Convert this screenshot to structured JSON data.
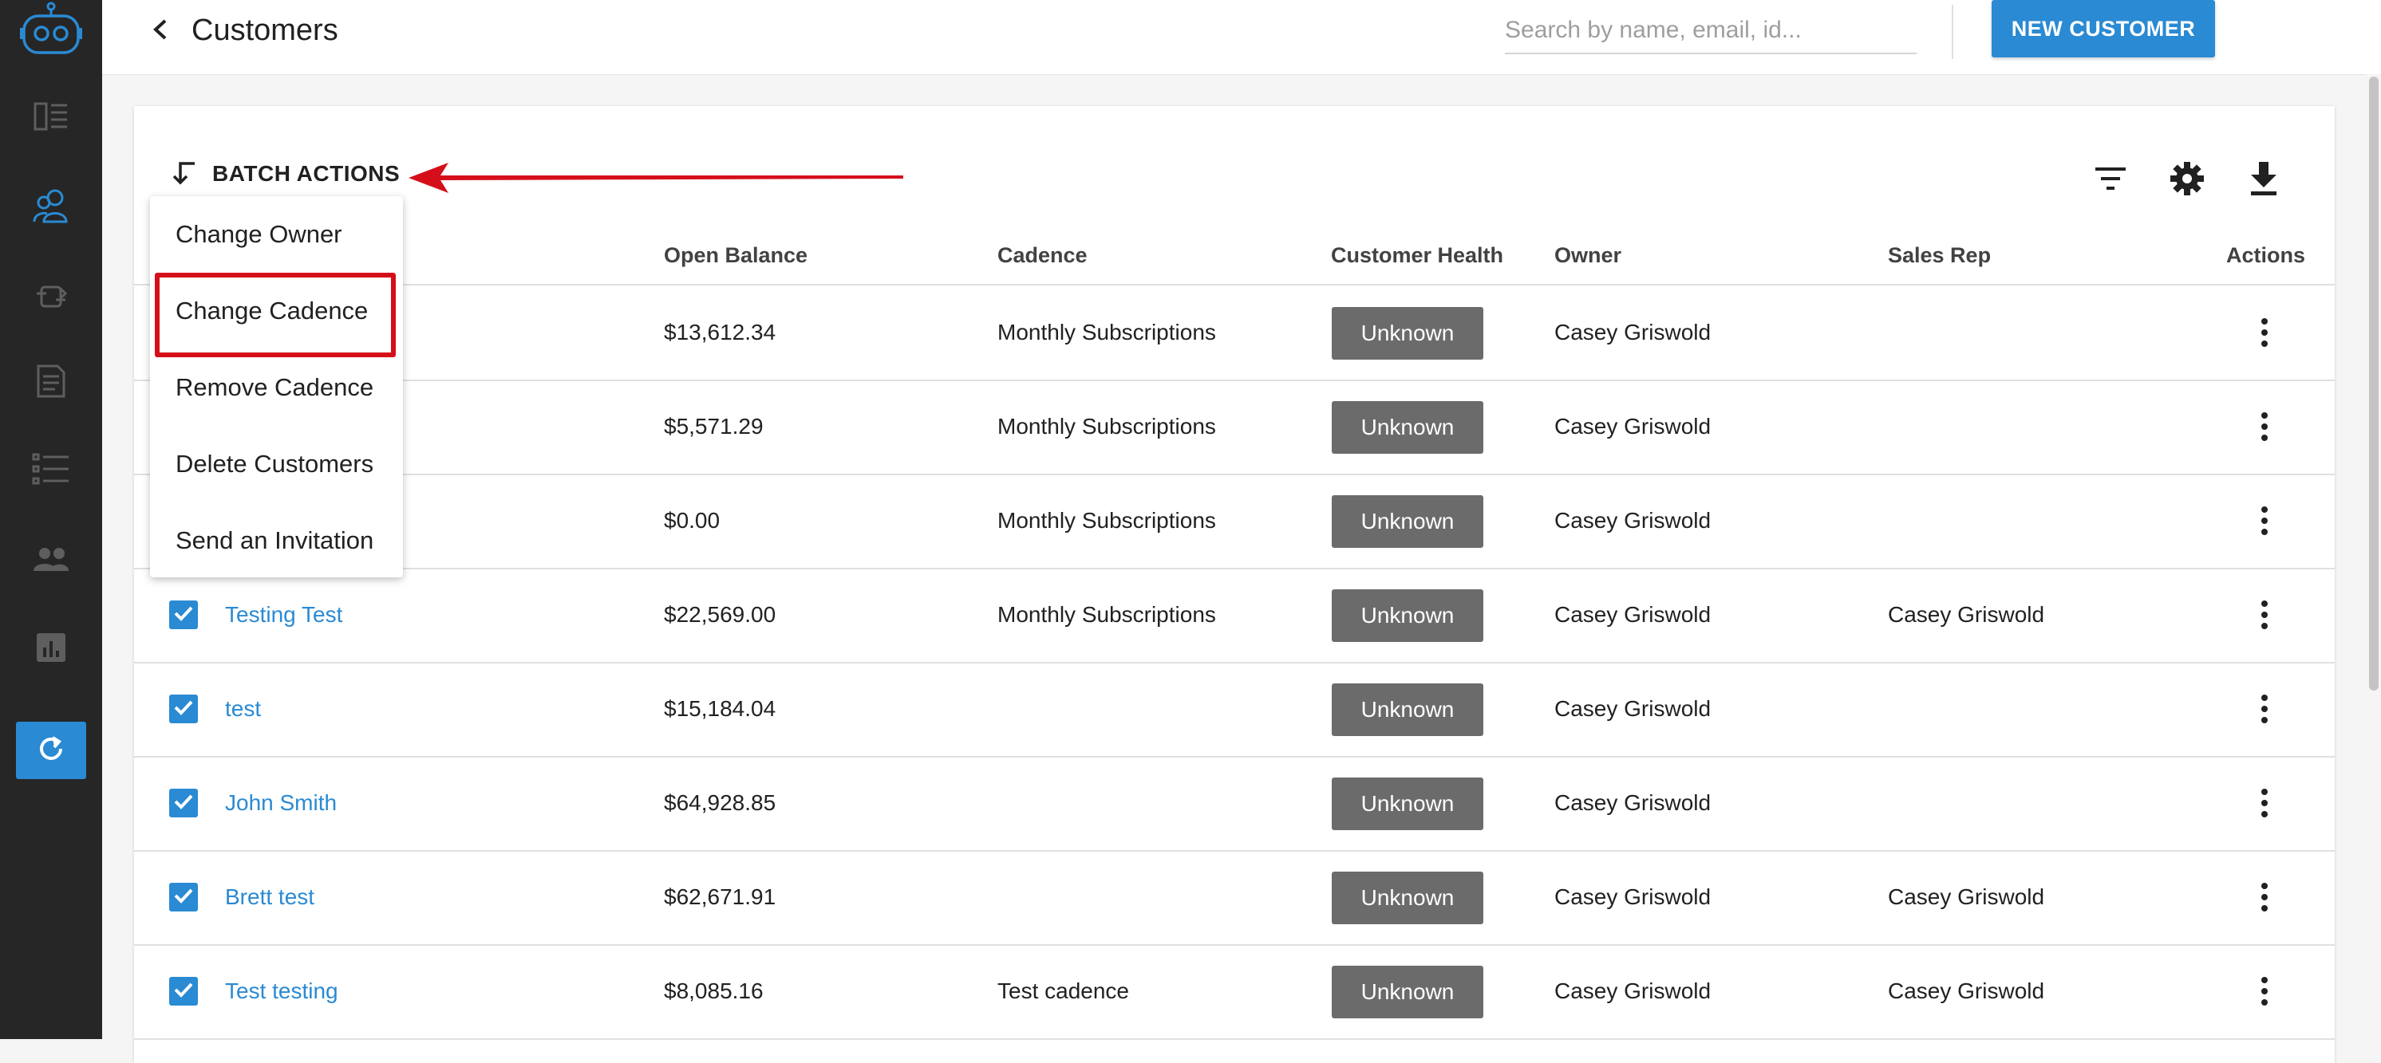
{
  "header": {
    "title": "Customers",
    "search_placeholder": "Search by name, email, id...",
    "new_customer_label": "NEW CUSTOMER"
  },
  "toolbar": {
    "batch_actions_label": "BATCH ACTIONS"
  },
  "batch_menu": {
    "items": [
      "Change Owner",
      "Change Cadence",
      "Remove Cadence",
      "Delete Customers",
      "Send an Invitation"
    ],
    "highlighted": "Change Cadence"
  },
  "table": {
    "columns": [
      "Open Balance",
      "Cadence",
      "Customer Health",
      "Owner",
      "Sales Rep",
      "Actions"
    ],
    "rows": [
      {
        "name": "",
        "balance": "$13,612.34",
        "cadence": "Monthly Subscriptions",
        "health": "Unknown",
        "owner": "Casey Griswold",
        "sales_rep": ""
      },
      {
        "name": "",
        "balance": "$5,571.29",
        "cadence": "Monthly Subscriptions",
        "health": "Unknown",
        "owner": "Casey Griswold",
        "sales_rep": ""
      },
      {
        "name": "",
        "balance": "$0.00",
        "cadence": "Monthly Subscriptions",
        "health": "Unknown",
        "owner": "Casey Griswold",
        "sales_rep": ""
      },
      {
        "name": "Testing Test",
        "balance": "$22,569.00",
        "cadence": "Monthly Subscriptions",
        "health": "Unknown",
        "owner": "Casey Griswold",
        "sales_rep": "Casey Griswold"
      },
      {
        "name": "test",
        "balance": "$15,184.04",
        "cadence": "",
        "health": "Unknown",
        "owner": "Casey Griswold",
        "sales_rep": ""
      },
      {
        "name": "John Smith",
        "balance": "$64,928.85",
        "cadence": "",
        "health": "Unknown",
        "owner": "Casey Griswold",
        "sales_rep": ""
      },
      {
        "name": "Brett test",
        "balance": "$62,671.91",
        "cadence": "",
        "health": "Unknown",
        "owner": "Casey Griswold",
        "sales_rep": "Casey Griswold"
      },
      {
        "name": "Test testing",
        "balance": "$8,085.16",
        "cadence": "Test cadence",
        "health": "Unknown",
        "owner": "Casey Griswold",
        "sales_rep": "Casey Griswold"
      }
    ]
  },
  "sidebar": {
    "icons": [
      "robot-logo-icon",
      "dashboard-icon",
      "customers-icon",
      "transfer-icon",
      "document-icon",
      "list-icon",
      "team-icon",
      "reports-icon",
      "refresh-icon"
    ]
  },
  "colors": {
    "accent": "#2a8ad3",
    "sidebar": "#262626",
    "health_badge": "#6b6b6b",
    "annotation_red": "#d50f1a"
  }
}
